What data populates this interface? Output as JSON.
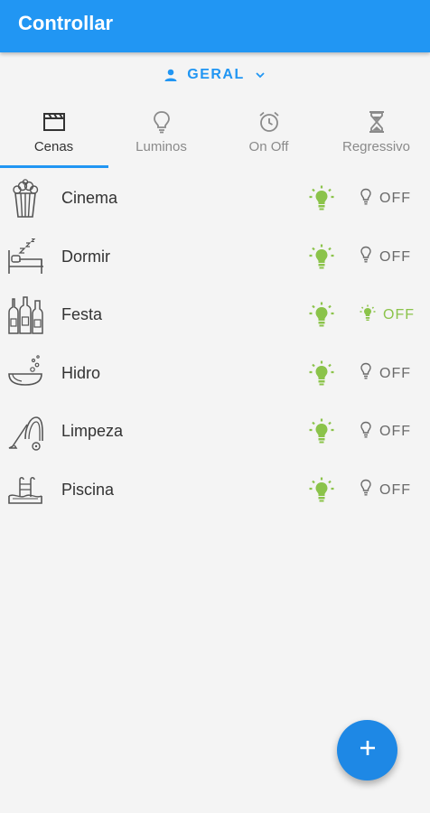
{
  "app": {
    "title": "Controllar"
  },
  "profile": {
    "icon": "person-icon",
    "label": "GERAL",
    "caret": "chevron-down-icon"
  },
  "tabs": [
    {
      "label": "Cenas",
      "icon": "clapperboard-icon",
      "active": true
    },
    {
      "label": "Luminos",
      "icon": "lightbulb-outline-icon",
      "active": false
    },
    {
      "label": "On Off",
      "icon": "alarm-clock-icon",
      "active": false
    },
    {
      "label": "Regressivo",
      "icon": "hourglass-icon",
      "active": false
    }
  ],
  "scenes": [
    {
      "name": "Cinema",
      "icon": "popcorn-icon",
      "off_label": "OFF",
      "off_active": false
    },
    {
      "name": "Dormir",
      "icon": "bed-sleep-icon",
      "off_label": "OFF",
      "off_active": false
    },
    {
      "name": "Festa",
      "icon": "bottles-icon",
      "off_label": "OFF",
      "off_active": true
    },
    {
      "name": "Hidro",
      "icon": "bathtub-icon",
      "off_label": "OFF",
      "off_active": false
    },
    {
      "name": "Limpeza",
      "icon": "vacuum-cleaner-icon",
      "off_label": "OFF",
      "off_active": false
    },
    {
      "name": "Piscina",
      "icon": "pool-icon",
      "off_label": "OFF",
      "off_active": false
    }
  ],
  "fab": {
    "icon": "plus-icon"
  },
  "colors": {
    "primary": "#2196f3",
    "bulb_on": "#8bc34a",
    "bulb_off": "#6a6a6a",
    "fab": "#1e88e5"
  }
}
